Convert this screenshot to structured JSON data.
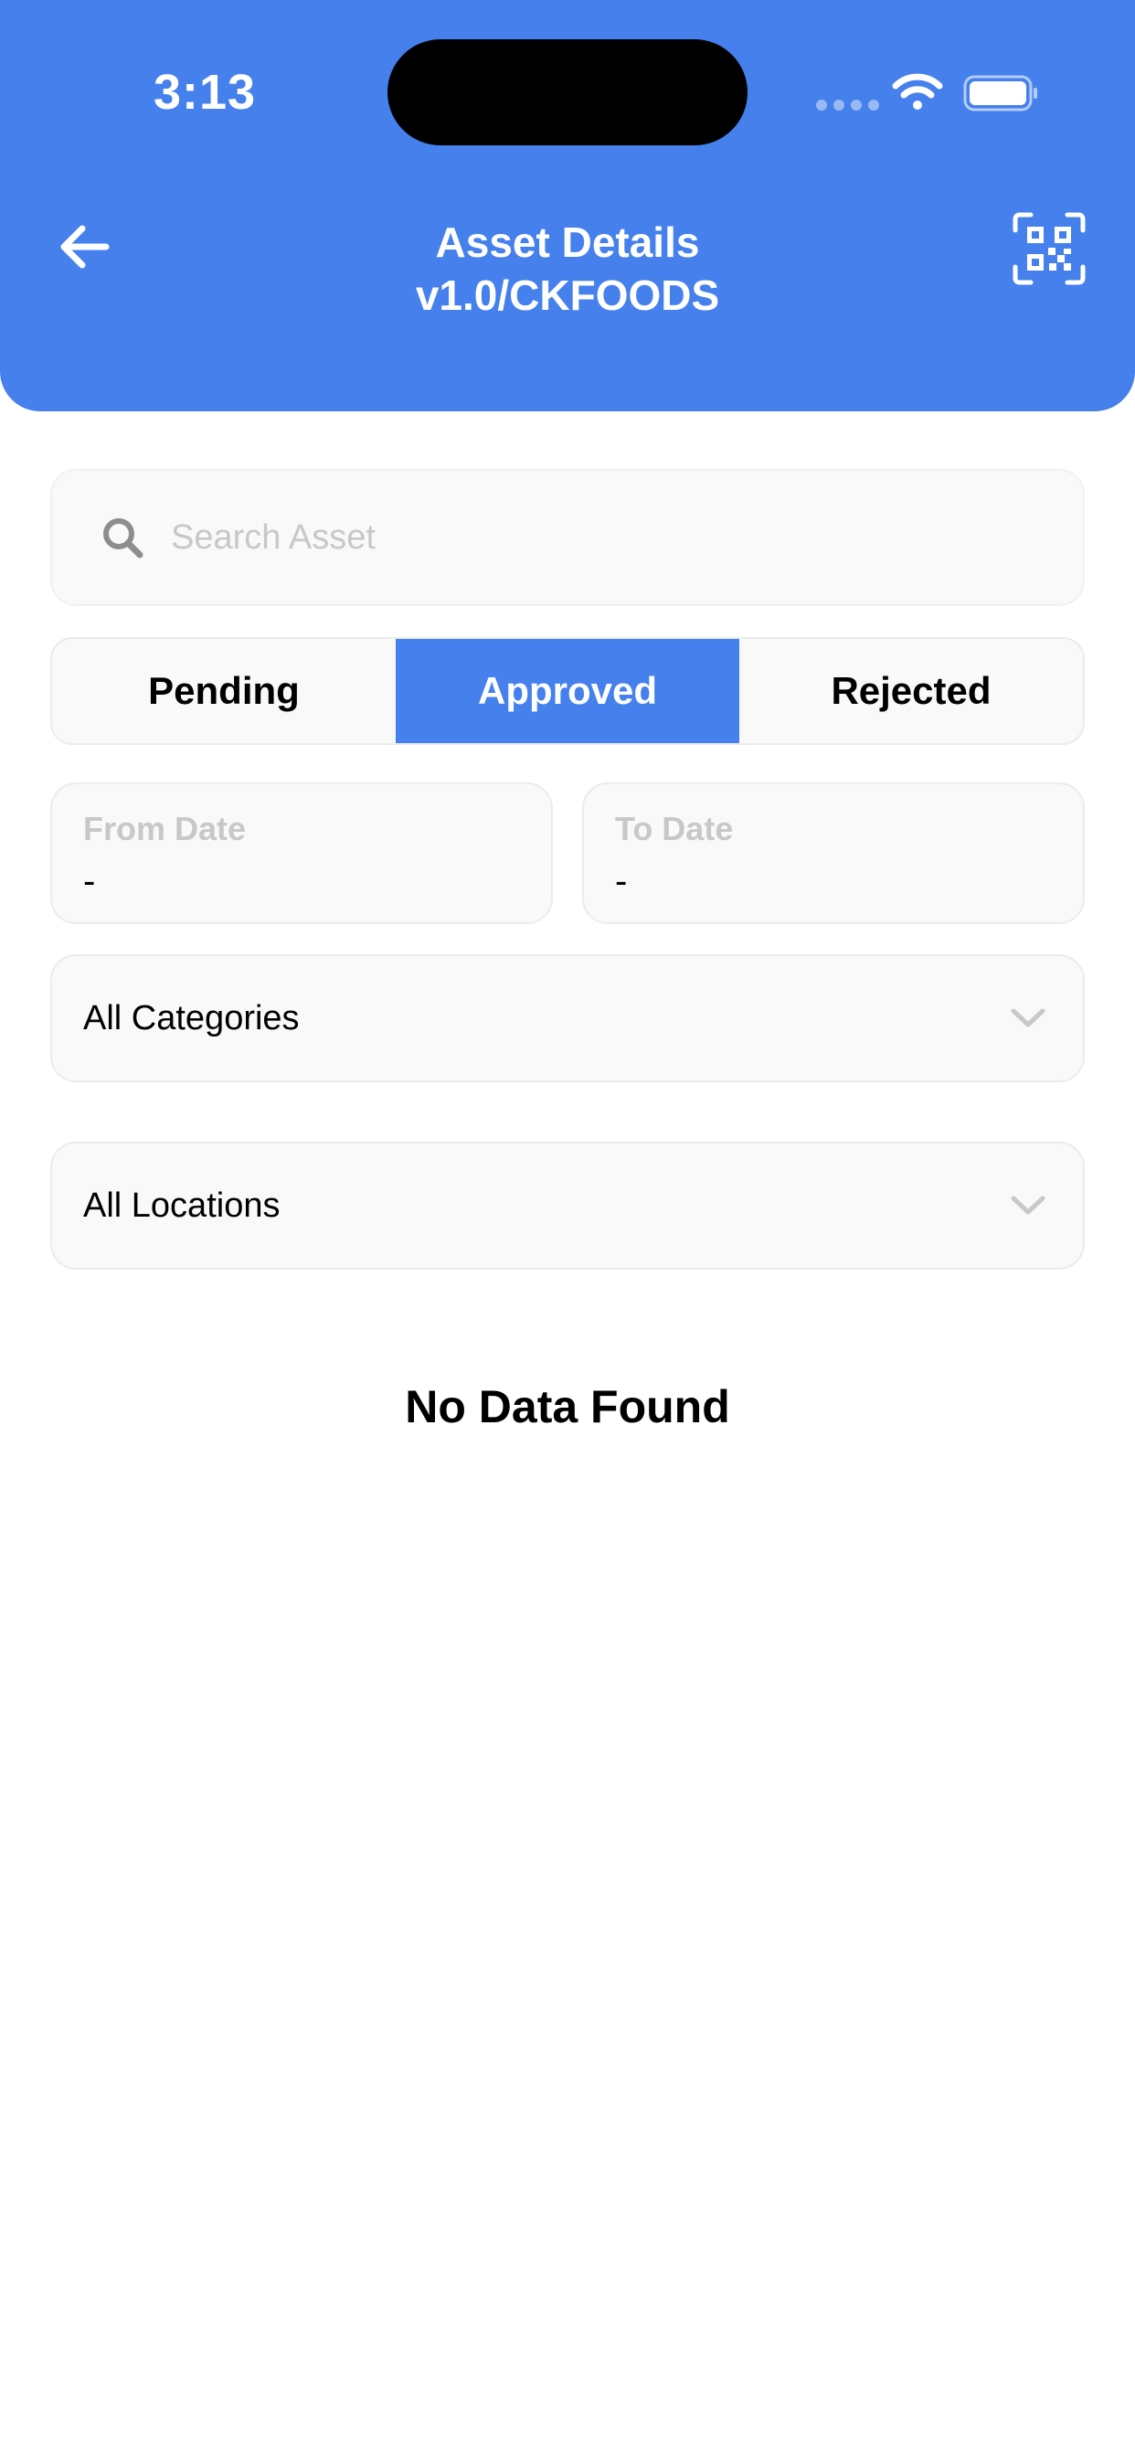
{
  "status_bar": {
    "time": "3:13"
  },
  "header": {
    "title": "Asset Details",
    "subtitle": "v1.0/CKFOODS",
    "back_icon": "arrow-left-icon",
    "scan_icon": "qr-code-scan-icon",
    "background_color": "#4580ec"
  },
  "search": {
    "placeholder": "Search Asset",
    "value": "",
    "icon": "search-icon"
  },
  "tabs": [
    {
      "label": "Pending",
      "active": false
    },
    {
      "label": "Approved",
      "active": true
    },
    {
      "label": "Rejected",
      "active": false
    }
  ],
  "filters": {
    "from_date": {
      "label": "From Date",
      "value": "-"
    },
    "to_date": {
      "label": "To Date",
      "value": "-"
    },
    "category": {
      "selected": "All Categories",
      "icon": "chevron-down-icon"
    },
    "location": {
      "selected": "All Locations",
      "icon": "chevron-down-icon"
    }
  },
  "empty_state": {
    "message": "No Data Found"
  },
  "colors": {
    "accent": "#4580ec",
    "field_background": "#f9f9f9",
    "placeholder_text": "#c8c8c8"
  }
}
